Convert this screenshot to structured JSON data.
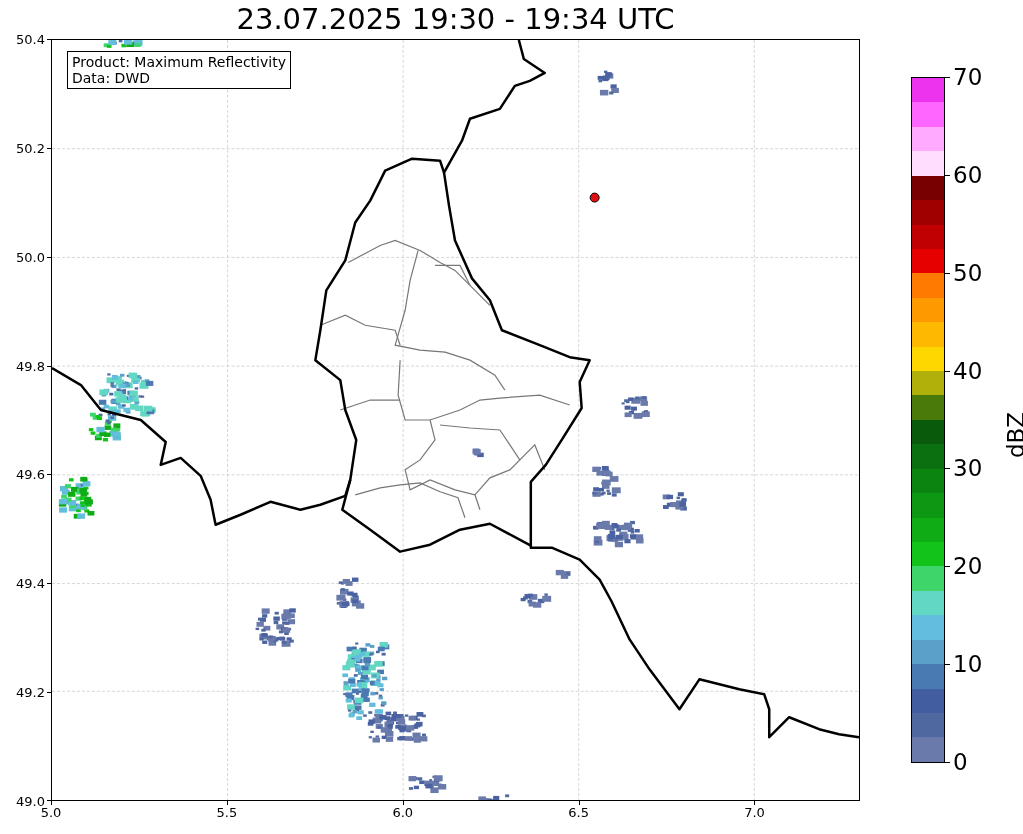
{
  "title": "23.07.2025 19:30 - 19:34 UTC",
  "map": {
    "info_box": [
      "Product: Maximum Reflectivity",
      "Data: DWD"
    ],
    "y_ticks": [
      "50.4",
      "50.2",
      "50.0",
      "49.8",
      "49.6",
      "49.4",
      "49.2",
      "49.0"
    ],
    "x_ticks": [
      "5.0",
      "5.5",
      "6.0",
      "6.5",
      "7.0"
    ]
  },
  "colorbar": {
    "label": "dBZ",
    "ticks": [
      "70",
      "60",
      "50",
      "40",
      "30",
      "20",
      "10",
      "0"
    ],
    "segments": [
      {
        "color": "#ee33ee"
      },
      {
        "color": "#ff66ff"
      },
      {
        "color": "#ffaaff"
      },
      {
        "color": "#ffddff"
      },
      {
        "color": "#780000"
      },
      {
        "color": "#a00000"
      },
      {
        "color": "#c00000"
      },
      {
        "color": "#e60000"
      },
      {
        "color": "#ff7a00"
      },
      {
        "color": "#ff9900"
      },
      {
        "color": "#ffb800"
      },
      {
        "color": "#ffd700"
      },
      {
        "color": "#b0b00a"
      },
      {
        "color": "#4a7a0a"
      },
      {
        "color": "#0a5a0c"
      },
      {
        "color": "#0b700f"
      },
      {
        "color": "#0b8410"
      },
      {
        "color": "#0c9812"
      },
      {
        "color": "#0fac16"
      },
      {
        "color": "#12c41a"
      },
      {
        "color": "#3ed66a"
      },
      {
        "color": "#62d8c4"
      },
      {
        "color": "#62bedc"
      },
      {
        "color": "#5aa0c8"
      },
      {
        "color": "#4a7ab2"
      },
      {
        "color": "#435ea0"
      },
      {
        "color": "#5068a0"
      },
      {
        "color": "#6a7aaa"
      }
    ]
  }
}
